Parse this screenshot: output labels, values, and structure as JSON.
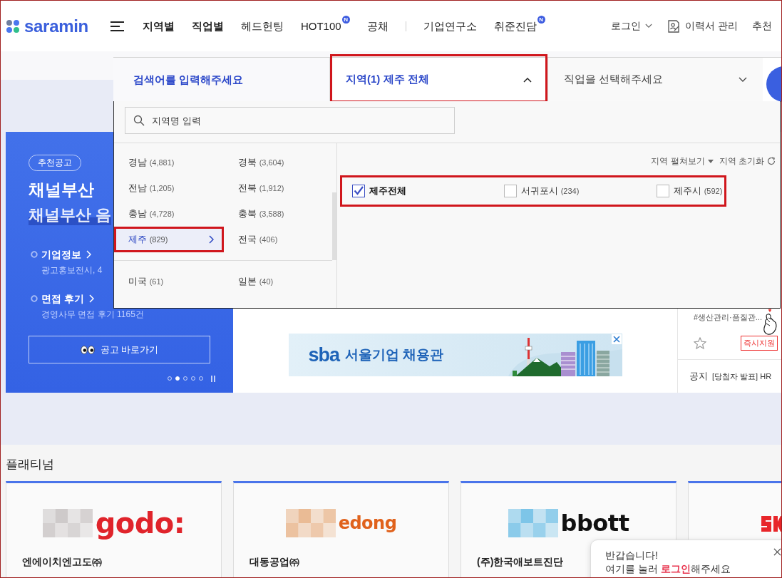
{
  "header": {
    "logo": "saramin",
    "nav": [
      {
        "label": "지역별",
        "strong": true
      },
      {
        "label": "직업별",
        "strong": true
      },
      {
        "label": "헤드헌팅",
        "strong": false
      },
      {
        "label": "HOT100",
        "strong": false,
        "badge": "N"
      },
      {
        "label": "공채",
        "strong": false
      }
    ],
    "nav_secondary": [
      {
        "label": "기업연구소",
        "strong": false
      },
      {
        "label": "취준진담",
        "strong": false,
        "badge": "N"
      }
    ],
    "user_menu": [
      {
        "label": "로그인",
        "kind": "dropdown"
      },
      {
        "label": "이력서 관리",
        "kind": "resume"
      },
      {
        "label": "추천",
        "kind": "plain"
      }
    ]
  },
  "search_bar": {
    "keyword": {
      "placeholder": "검색어를 입력해주세요"
    },
    "region": {
      "label": "지역(1) 제주 전체",
      "expanded": true,
      "annotated": true
    },
    "job": {
      "label": "직업을 선택해주세요",
      "expanded": false
    }
  },
  "region_dropdown": {
    "search": {
      "placeholder": "지역명 입력"
    },
    "domestic": [
      {
        "name": "경남",
        "count": "(4,881)",
        "selected": false,
        "annotated": false
      },
      {
        "name": "경북",
        "count": "(3,604)",
        "selected": false,
        "annotated": false
      },
      {
        "name": "전남",
        "count": "(1,205)",
        "selected": false,
        "annotated": false
      },
      {
        "name": "전북",
        "count": "(1,912)",
        "selected": false,
        "annotated": false
      },
      {
        "name": "충남",
        "count": "(4,728)",
        "selected": false,
        "annotated": false
      },
      {
        "name": "충북",
        "count": "(3,588)",
        "selected": false,
        "annotated": false
      },
      {
        "name": "제주",
        "count": "(829)",
        "selected": true,
        "annotated": true
      },
      {
        "name": "전국",
        "count": "(406)",
        "selected": false,
        "annotated": false
      }
    ],
    "overseas": [
      {
        "name": "미국",
        "count": "(61)",
        "selected": false
      },
      {
        "name": "일본",
        "count": "(40)",
        "selected": false
      }
    ],
    "tools": [
      {
        "label": "지역 펼쳐보기",
        "kind": "expand"
      },
      {
        "label": "지역 초기화",
        "kind": "reset"
      }
    ],
    "sub_regions": [
      {
        "name": "제주전체",
        "checked": true
      },
      {
        "name": "서귀포시",
        "count": "(234)",
        "checked": false
      },
      {
        "name": "제주시",
        "count": "(592)",
        "checked": false
      }
    ],
    "sub_regions_annotated": true
  },
  "hero": {
    "card": {
      "badge": "추천공고",
      "title": "채널부산",
      "subtitle": "채널부산 음",
      "links": [
        {
          "label": "기업정보",
          "detail": "광고홍보전시, 4"
        },
        {
          "label": "면접 후기",
          "detail": "경영사무 면접 후기 1165건"
        }
      ],
      "button": "공고 바로가기",
      "slides": [
        {
          "selected": false
        },
        {
          "selected": true
        },
        {
          "selected": false
        },
        {
          "selected": false
        },
        {
          "selected": false
        }
      ]
    },
    "banner": {
      "brand": "sba",
      "title": "서울기업 채용관"
    },
    "side": {
      "tagline": "#생산관리·품질관...",
      "favorite": false,
      "apply_tag": "즉시지원",
      "notice_label": "공지",
      "notice": "[당첨자 발표] HR"
    }
  },
  "platinum": {
    "title": "플래티넘",
    "companies": [
      {
        "name": "엔에이치엔고도㈜",
        "logo_text": "godo:",
        "color": "#e0242b"
      },
      {
        "name": "대동공업㈜",
        "logo_text": "edong",
        "color": "#e0621c"
      },
      {
        "name": "(주)한국애보트진단",
        "logo_text": "bbott",
        "color": "#111111"
      },
      {
        "color": "#e8262a"
      }
    ]
  },
  "login_popup": {
    "greeting": "반갑습니다!",
    "message": "여기를 눌러 **로그인**해주세요"
  }
}
